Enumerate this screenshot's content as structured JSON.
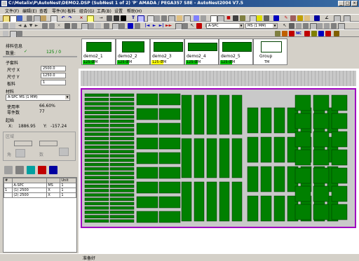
{
  "window": {
    "title": "C:\\Metalix\\P\\AutoNest\\DEMO2.DSP (SubNest 1 of 2) 'P' AMADA / PEGA357 S8E - AutoNest2004 V7.5",
    "minimize": "_",
    "maximize": "□",
    "close": "×"
  },
  "menu": [
    "文件(F)",
    "编辑(E)",
    "查看",
    "零件(R)",
    "板料",
    "组合(G)",
    "工具(B)",
    "设置",
    "帮助(H)"
  ],
  "toolbar": {
    "material_select": "A-SPC",
    "material_thickness": "MS (1 MM)"
  },
  "left_panel": {
    "status_label": "排料信息",
    "qty_label": "数量:",
    "qty_value": "125 / 0",
    "subnest_label": "子套料",
    "size_x_label": "尺寸 X",
    "size_x_value": "2500.0",
    "size_y_label": "尺寸 Y",
    "size_y_value": "1250.0",
    "sheets_label": "板料",
    "sheets_value": "1",
    "material_label": "材料",
    "material_value": "A-SPC MS (1 MM)",
    "usage_label": "使用率",
    "usage_value": "66.60%",
    "parts_label": "零件数",
    "parts_value": "77",
    "origin_label": "起始",
    "origin_x_label": "X:",
    "origin_x_value": "1886.95",
    "origin_y_label": "Y:",
    "origin_y_value": "-157.24",
    "disabled_group_label": "区域",
    "disabled_field1": "",
    "disabled_field2": "",
    "angle_label": "角",
    "count_label": "数",
    "table": {
      "col_num": "#",
      "col_name": "",
      "col_size": "",
      "col_unit": "Unit",
      "rows": [
        {
          "num": "",
          "name": "A-SPC",
          "size": "MS",
          "unit": "1"
        },
        {
          "num": "1",
          "name": "(1) 2500",
          "size": "X",
          "unit": "1"
        },
        {
          "num": "",
          "name": "(2) 2500",
          "size": "X",
          "unit": "1"
        }
      ]
    }
  },
  "thumbnails": [
    {
      "name": "demo2_1",
      "qty": "125-0",
      "qty_color": "green",
      "tm": "TM"
    },
    {
      "name": "demo2_2",
      "qty": "125-0",
      "qty_color": "green",
      "tm": "TM"
    },
    {
      "name": "demo2_3",
      "qty": "125-0",
      "qty_color": "yellow",
      "tm": "TM"
    },
    {
      "name": "demo2_4",
      "qty": "125-0",
      "qty_color": "green",
      "tm": "TM"
    },
    {
      "name": "demo2_5",
      "qty": "125-0",
      "qty_color": "green",
      "tm": "TM"
    },
    {
      "name": "Group",
      "qty": "",
      "qty_color": "none",
      "tm": "TM"
    }
  ],
  "status_bar": {
    "text": "准备好"
  },
  "colors": {
    "title_start": "#0a246a",
    "title_end": "#3a6ea5",
    "part_fill": "#008000",
    "sheet_border": "#a000c0",
    "sheet_bg": "#c9c9c9"
  }
}
